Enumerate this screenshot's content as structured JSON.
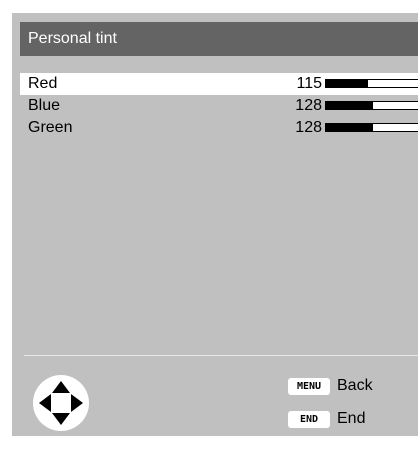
{
  "menu": {
    "title": "Personal tint",
    "settings": [
      {
        "label": "Red",
        "value": "115",
        "level": 0.45,
        "selected": true
      },
      {
        "label": "Blue",
        "value": "128",
        "level": 0.5,
        "selected": false
      },
      {
        "label": "Green",
        "value": "128",
        "level": 0.5,
        "selected": false
      }
    ]
  },
  "footer": {
    "navigation_icon": "dpad-arrows-icon",
    "keys": [
      {
        "key": "MENU",
        "label": "Back"
      },
      {
        "key": "END",
        "label": "End"
      }
    ]
  },
  "colors": {
    "panel": "#c0c0c0",
    "title_bar": "#646464",
    "selected_row": "#ffffff"
  }
}
